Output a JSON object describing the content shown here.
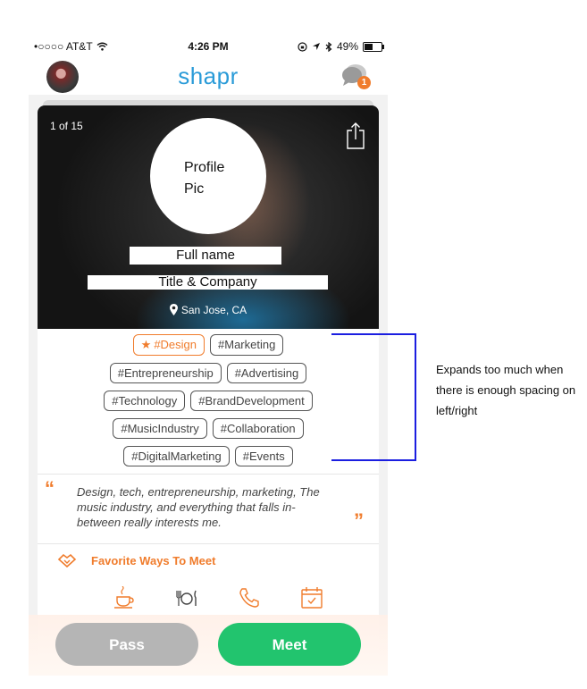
{
  "status_bar": {
    "carrier": "•○○○○ AT&T",
    "time": "4:26 PM",
    "battery": "49%"
  },
  "navbar": {
    "logo": "shapr",
    "chat_badge": "1"
  },
  "card": {
    "counter": "1 of 15",
    "profile_pic": "Profile Pic",
    "full_name": "Full name",
    "title_company": "Title & Company",
    "location": "San Jose, CA"
  },
  "tags": [
    [
      "#Design",
      "#Marketing"
    ],
    [
      "#Entrepreneurship",
      "#Advertising"
    ],
    [
      "#Technology",
      "#BrandDevelopment"
    ],
    [
      "#MusicIndustry",
      "#Collaboration"
    ],
    [
      "#DigitalMarketing",
      "#Events"
    ]
  ],
  "quote": {
    "open": "“",
    "close": "”",
    "text": "Design, tech, entrepreneurship, marketing, The music industry, and everything that falls in-between really interests me."
  },
  "ways_to_meet": {
    "title": "Favorite Ways To Meet",
    "icons": [
      "coffee-icon",
      "meal-icon",
      "phone-icon",
      "calendar-icon"
    ]
  },
  "buttons": {
    "pass": "Pass",
    "meet": "Meet"
  },
  "annotation": "Expands too much when there is enough spacing on left/right",
  "colors": {
    "accent": "#f07c2c",
    "brand": "#2a9bd8",
    "meet": "#22c46e",
    "pass": "#b5b5b5",
    "annotation": "#1b1ee0"
  }
}
